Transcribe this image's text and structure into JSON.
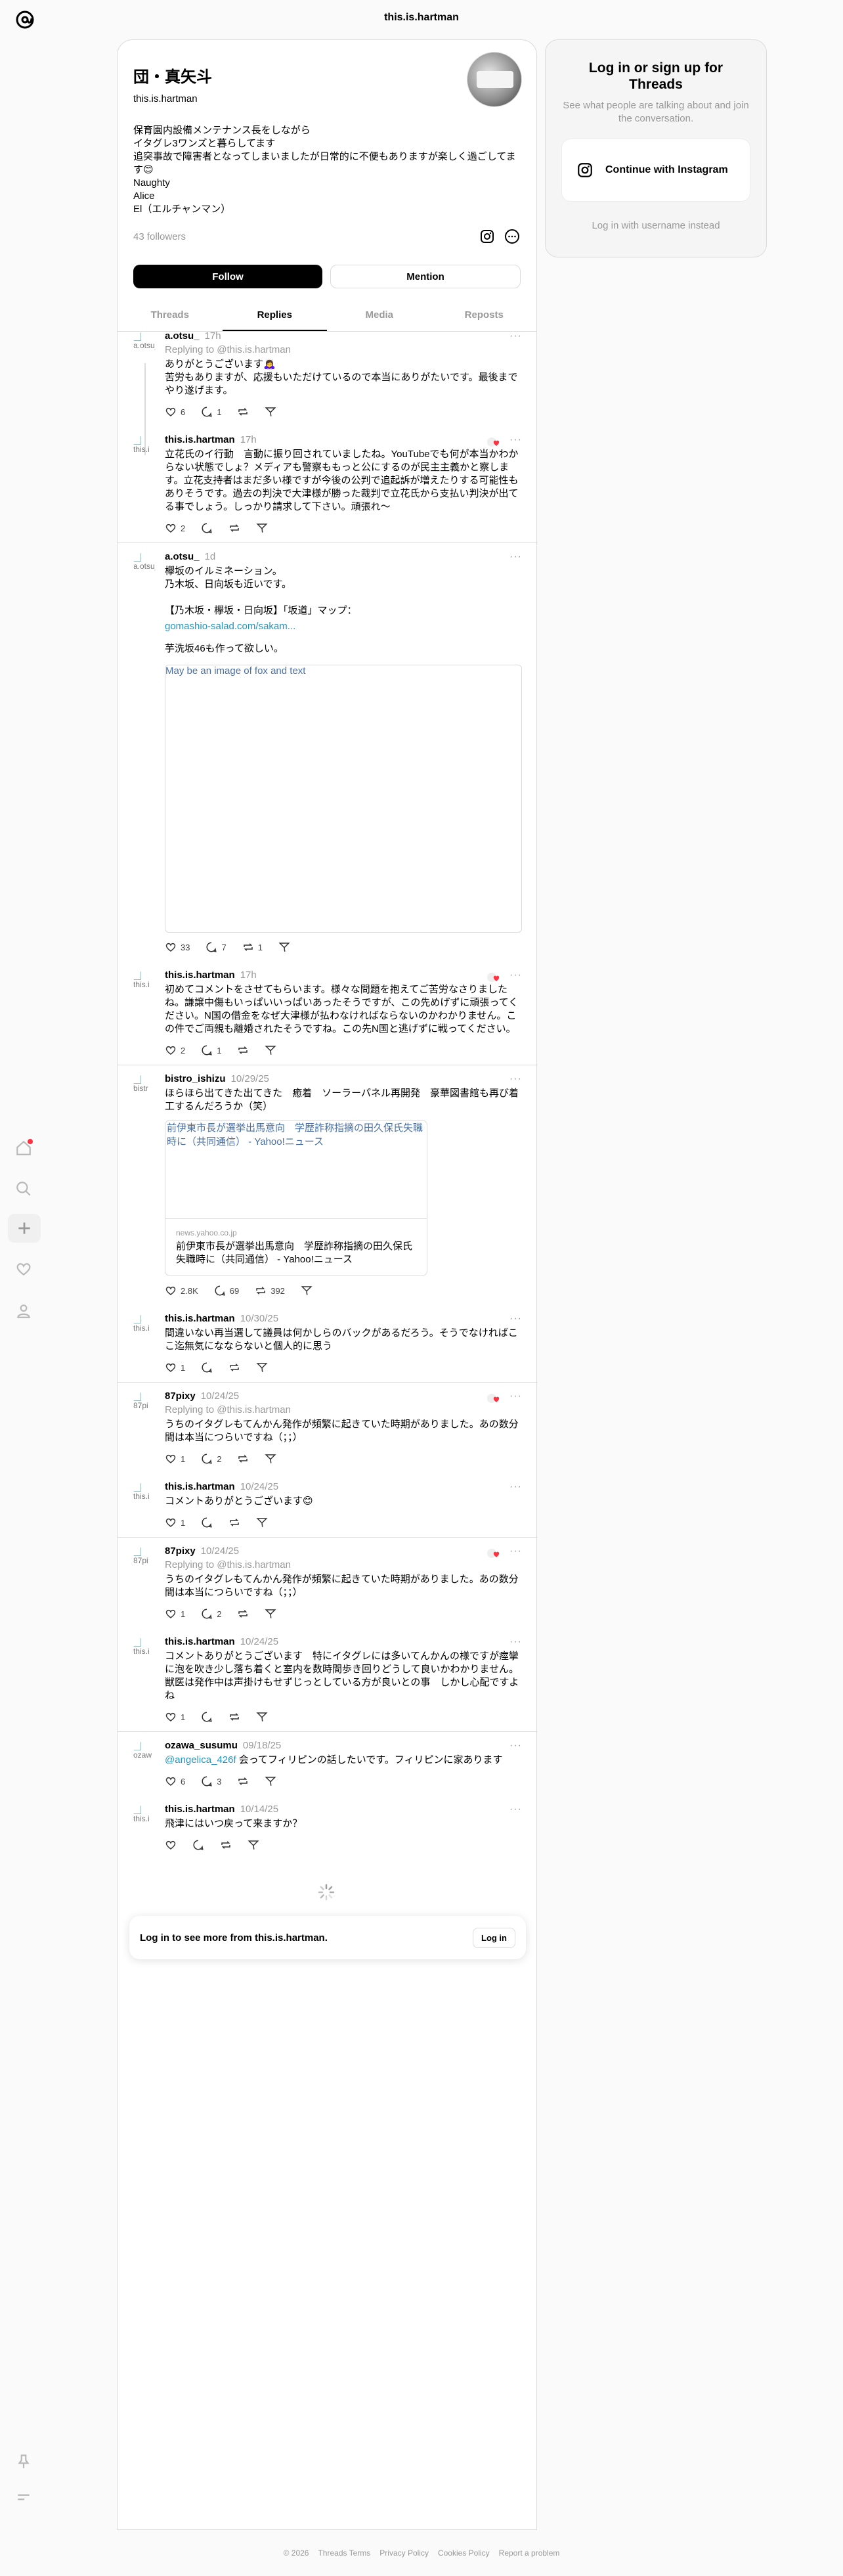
{
  "top": {
    "title": "this.is.hartman"
  },
  "profile": {
    "name": "団・真矢斗",
    "handle": "this.is.hartman",
    "bio": "保育園内設備メンテナンス長をしながら\nイタグレ3ワンズと暮らしてます\n追突事故で障害者となってしまいましたが日常的に不便もありますが楽しく過ごしてます😊\nNaughty\nAlice\nEl（エルチャンマン）",
    "followers": "43 followers",
    "follow_label": "Follow",
    "mention_label": "Mention"
  },
  "tabs": [
    "Threads",
    "Replies",
    "Media",
    "Reposts"
  ],
  "posts": [
    {
      "user": "a.otsu_",
      "time": "17h",
      "replying": "Replying to @this.is.hartman",
      "text": "ありがとうございます🙇‍♀️\n苦労もありますが、応援もいただけているので本当にありがたいです。最後までやり遂げます。",
      "likes": "6",
      "replies": "1",
      "reposts": "",
      "avatar_alt": "a.otsu_"
    },
    {
      "user": "this.is.hartman",
      "time": "17h",
      "text": "立花氏のイ行動　言動に振り回されていましたね。YouTubeでも何が本当かわからない状態でしょ？メディアも警察ももっと公にするのが民主主義かと察します。立花支持者はまだ多い様ですが今後の公判で追起訴が増えたりする可能性もありそうです。過去の判決で大津様が勝った裁判で立花氏から支払い判決が出てる事でしょう。しっかり請求して下さい。頑張れ〜",
      "likes": "2",
      "replies": "",
      "reposts": "",
      "avatar_alt": "this.i"
    },
    {
      "user": "a.otsu_",
      "time": "1d",
      "text_pre": "欅坂のイルミネーション。\n乃木坂、日向坂も近いです。\n\n【乃木坂・欅坂・日向坂】「坂道」マップ：",
      "link": "gomashio-salad.com/sakam...",
      "text_post": "芋洗坂46も作って欲しい。",
      "image_alt": "May be an image of fox and text",
      "likes": "33",
      "replies": "7",
      "reposts": "1",
      "avatar_alt": "a.otsu_"
    },
    {
      "user": "this.is.hartman",
      "time": "17h",
      "text": "初めてコメントをさせてもらいます。様々な問題を抱えてご苦労なさりましたね。謙譲中傷もいっぱいいっぱいあったそうですが、この先めげずに頑張ってください。N国の借金をなぜ大津様が払わなければならないのかわかりません。この件でご両親も離婚されたそうですね。この先N国と逃げずに戦ってください。",
      "likes": "2",
      "replies": "1",
      "reposts": "",
      "avatar_alt": "this.i"
    },
    {
      "user": "bistro_ishizu",
      "time": "10/29/25",
      "text": "ほらほら出てきた出てきた　癒着　ソーラーパネル再開発　豪華図書館も再び着工するんだろうか（笑）",
      "card_img_alt": "前伊東市長が選挙出馬意向　学歴詐称指摘の田久保氏失職時に（共同通信） - Yahoo!ニュース",
      "card_domain": "news.yahoo.co.jp",
      "card_title": "前伊東市長が選挙出馬意向　学歴詐称指摘の田久保氏失職時に（共同通信） - Yahoo!ニュース",
      "likes": "2.8K",
      "replies": "69",
      "reposts": "392",
      "avatar_alt": "bistr"
    },
    {
      "user": "this.is.hartman",
      "time": "10/30/25",
      "text": "間違いない再当選して議員は何かしらのバックがあるだろう。そうでなければここ迄無気になならないと個人的に思う",
      "likes": "1",
      "replies": "",
      "reposts": "",
      "avatar_alt": "this.i"
    },
    {
      "user": "87pixy",
      "time": "10/24/25",
      "replying": "Replying to @this.is.hartman",
      "text": "うちのイタグレもてんかん発作が頻繁に起きていた時期がありました。あの数分間は本当につらいですね（；；）",
      "likes": "1",
      "replies": "2",
      "reposts": "",
      "avatar_alt": "87pi"
    },
    {
      "user": "this.is.hartman",
      "time": "10/24/25",
      "text": "コメントありがとうございます😊",
      "likes": "1",
      "replies": "",
      "reposts": "",
      "avatar_alt": "this.i"
    },
    {
      "user": "87pixy",
      "time": "10/24/25",
      "replying": "Replying to @this.is.hartman",
      "text": "うちのイタグレもてんかん発作が頻繁に起きていた時期がありました。あの数分間は本当につらいですね（；；）",
      "likes": "1",
      "replies": "2",
      "reposts": "",
      "avatar_alt": "87pi"
    },
    {
      "user": "this.is.hartman",
      "time": "10/24/25",
      "text": "コメントありがとうございます　特にイタグレには多いてんかんの様ですが痙攣に泡を吹き少し落ち着くと室内を数時間歩き回りどうして良いかわかりません。獣医は発作中は声掛けもせずじっとしている方が良いとの事　しかし心配ですよね",
      "likes": "1",
      "replies": "",
      "reposts": "",
      "avatar_alt": "this.i"
    },
    {
      "user": "ozawa_susumu",
      "time": "09/18/25",
      "mention": "@angelica_426f",
      "text": " 会ってフィリピンの話したいです。フィリピンに家あります",
      "likes": "6",
      "replies": "3",
      "reposts": "",
      "avatar_alt": "ozaw"
    },
    {
      "user": "this.is.hartman",
      "time": "10/14/25",
      "text": "飛津にはいつ戻って来ますか？",
      "likes": "",
      "replies": "",
      "reposts": "",
      "avatar_alt": "this.i"
    }
  ],
  "login_card": {
    "text": "Log in to see more from this.is.hartman.",
    "button": "Log in"
  },
  "side": {
    "title": "Log in or sign up for Threads",
    "subtitle": "See what people are talking about and join the conversation.",
    "instagram": "Continue with Instagram",
    "alt": "Log in with username instead"
  },
  "footer": [
    "© 2026",
    "Threads Terms",
    "Privacy Policy",
    "Cookies Policy",
    "Report a problem"
  ]
}
